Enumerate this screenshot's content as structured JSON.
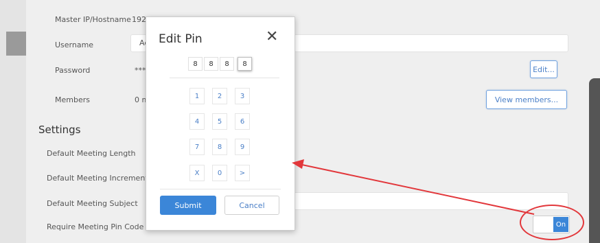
{
  "account": {
    "master_ip_label": "Master IP/Hostname",
    "master_ip_value": "192",
    "username_label": "Username",
    "username_value": "Ac",
    "password_label": "Password",
    "password_value": "***",
    "members_label": "Members",
    "members_value": "0 m",
    "edit_button": "Edit...",
    "view_members_button": "View members..."
  },
  "settings": {
    "heading": "Settings",
    "default_meeting_length_label": "Default Meeting Length",
    "default_meeting_increment_label": "Default Meeting Increment",
    "default_meeting_subject_label": "Default Meeting Subject",
    "require_pin_label": "Require Meeting Pin Code",
    "require_pin_toggle": "On"
  },
  "dialog": {
    "title": "Edit Pin",
    "close_glyph": "✕",
    "pin_digits": [
      "8",
      "8",
      "8",
      "8"
    ],
    "keypad": [
      "1",
      "2",
      "3",
      "4",
      "5",
      "6",
      "7",
      "8",
      "9",
      "X",
      "0",
      ">"
    ],
    "submit_label": "Submit",
    "cancel_label": "Cancel"
  },
  "icons": {
    "close": "close-icon"
  },
  "colors": {
    "accent": "#3b86d8",
    "annotation": "#e2373b"
  }
}
